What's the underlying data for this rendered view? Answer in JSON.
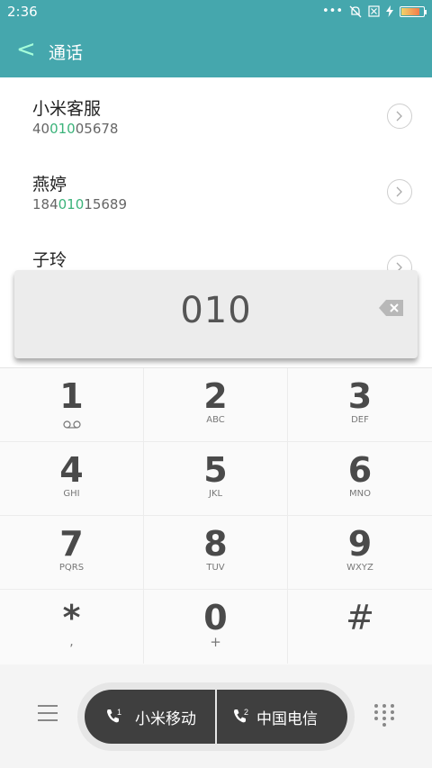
{
  "status": {
    "time": "2:36",
    "dots": "•••"
  },
  "header": {
    "title": "通话",
    "back_glyph": "<"
  },
  "contacts": [
    {
      "name": "小米客服",
      "num_prefix": "40",
      "num_match": "010",
      "num_suffix": "05678"
    },
    {
      "name": "燕婷",
      "num_prefix": "184",
      "num_match": "010",
      "num_suffix": "15689"
    },
    {
      "name": "子玲"
    }
  ],
  "dial_input": {
    "value": "010"
  },
  "keypad": [
    {
      "digit": "1",
      "letters": ""
    },
    {
      "digit": "2",
      "letters": "ABC"
    },
    {
      "digit": "3",
      "letters": "DEF"
    },
    {
      "digit": "4",
      "letters": "GHI"
    },
    {
      "digit": "5",
      "letters": "JKL"
    },
    {
      "digit": "6",
      "letters": "MNO"
    },
    {
      "digit": "7",
      "letters": "PQRS"
    },
    {
      "digit": "8",
      "letters": "TUV"
    },
    {
      "digit": "9",
      "letters": "WXYZ"
    },
    {
      "digit": "*",
      "letters": ","
    },
    {
      "digit": "0",
      "letters": "+"
    },
    {
      "digit": "#",
      "letters": ""
    }
  ],
  "call_buttons": {
    "sim1": {
      "label": "小米移动",
      "slot": "1"
    },
    "sim2": {
      "label": "中国电信",
      "slot": "2"
    }
  },
  "colors": {
    "accent": "#45a7ad",
    "match_highlight": "#3bb37a"
  }
}
